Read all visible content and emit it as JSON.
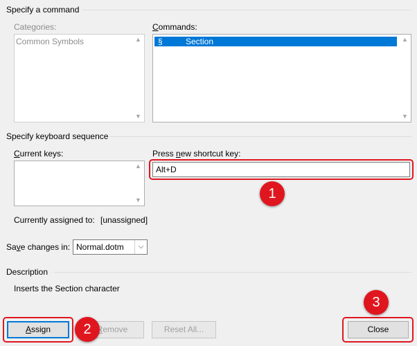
{
  "sections": {
    "command": "Specify a command",
    "keyboard": "Specify keyboard sequence",
    "description": "Description"
  },
  "categories": {
    "label": "Categories:",
    "items": [
      "Common Symbols"
    ]
  },
  "commands": {
    "label_pre": "",
    "label_u": "C",
    "label_post": "ommands:",
    "items": [
      {
        "symbol": "§",
        "name": "Section"
      }
    ]
  },
  "current_keys": {
    "label_pre": "",
    "label_u": "C",
    "label_post": "urrent keys:"
  },
  "new_shortcut": {
    "label_pre": "Press ",
    "label_u": "n",
    "label_post": "ew shortcut key:",
    "value": "Alt+D"
  },
  "assigned": {
    "label": "Currently assigned to:",
    "value": "[unassigned]"
  },
  "save_changes": {
    "label_pre": "Sa",
    "label_u": "v",
    "label_post": "e changes in:",
    "value": "Normal.dotm"
  },
  "description_text": "Inserts the Section character",
  "buttons": {
    "assign_u": "A",
    "assign_post": "ssign",
    "remove_pre": "",
    "remove_u": "R",
    "remove_post": "emove",
    "reset_all": "Reset All...",
    "close": "Close"
  },
  "callouts": [
    "1",
    "2",
    "3"
  ],
  "colors": {
    "callout": "#e0161f",
    "selection": "#0078d7"
  }
}
